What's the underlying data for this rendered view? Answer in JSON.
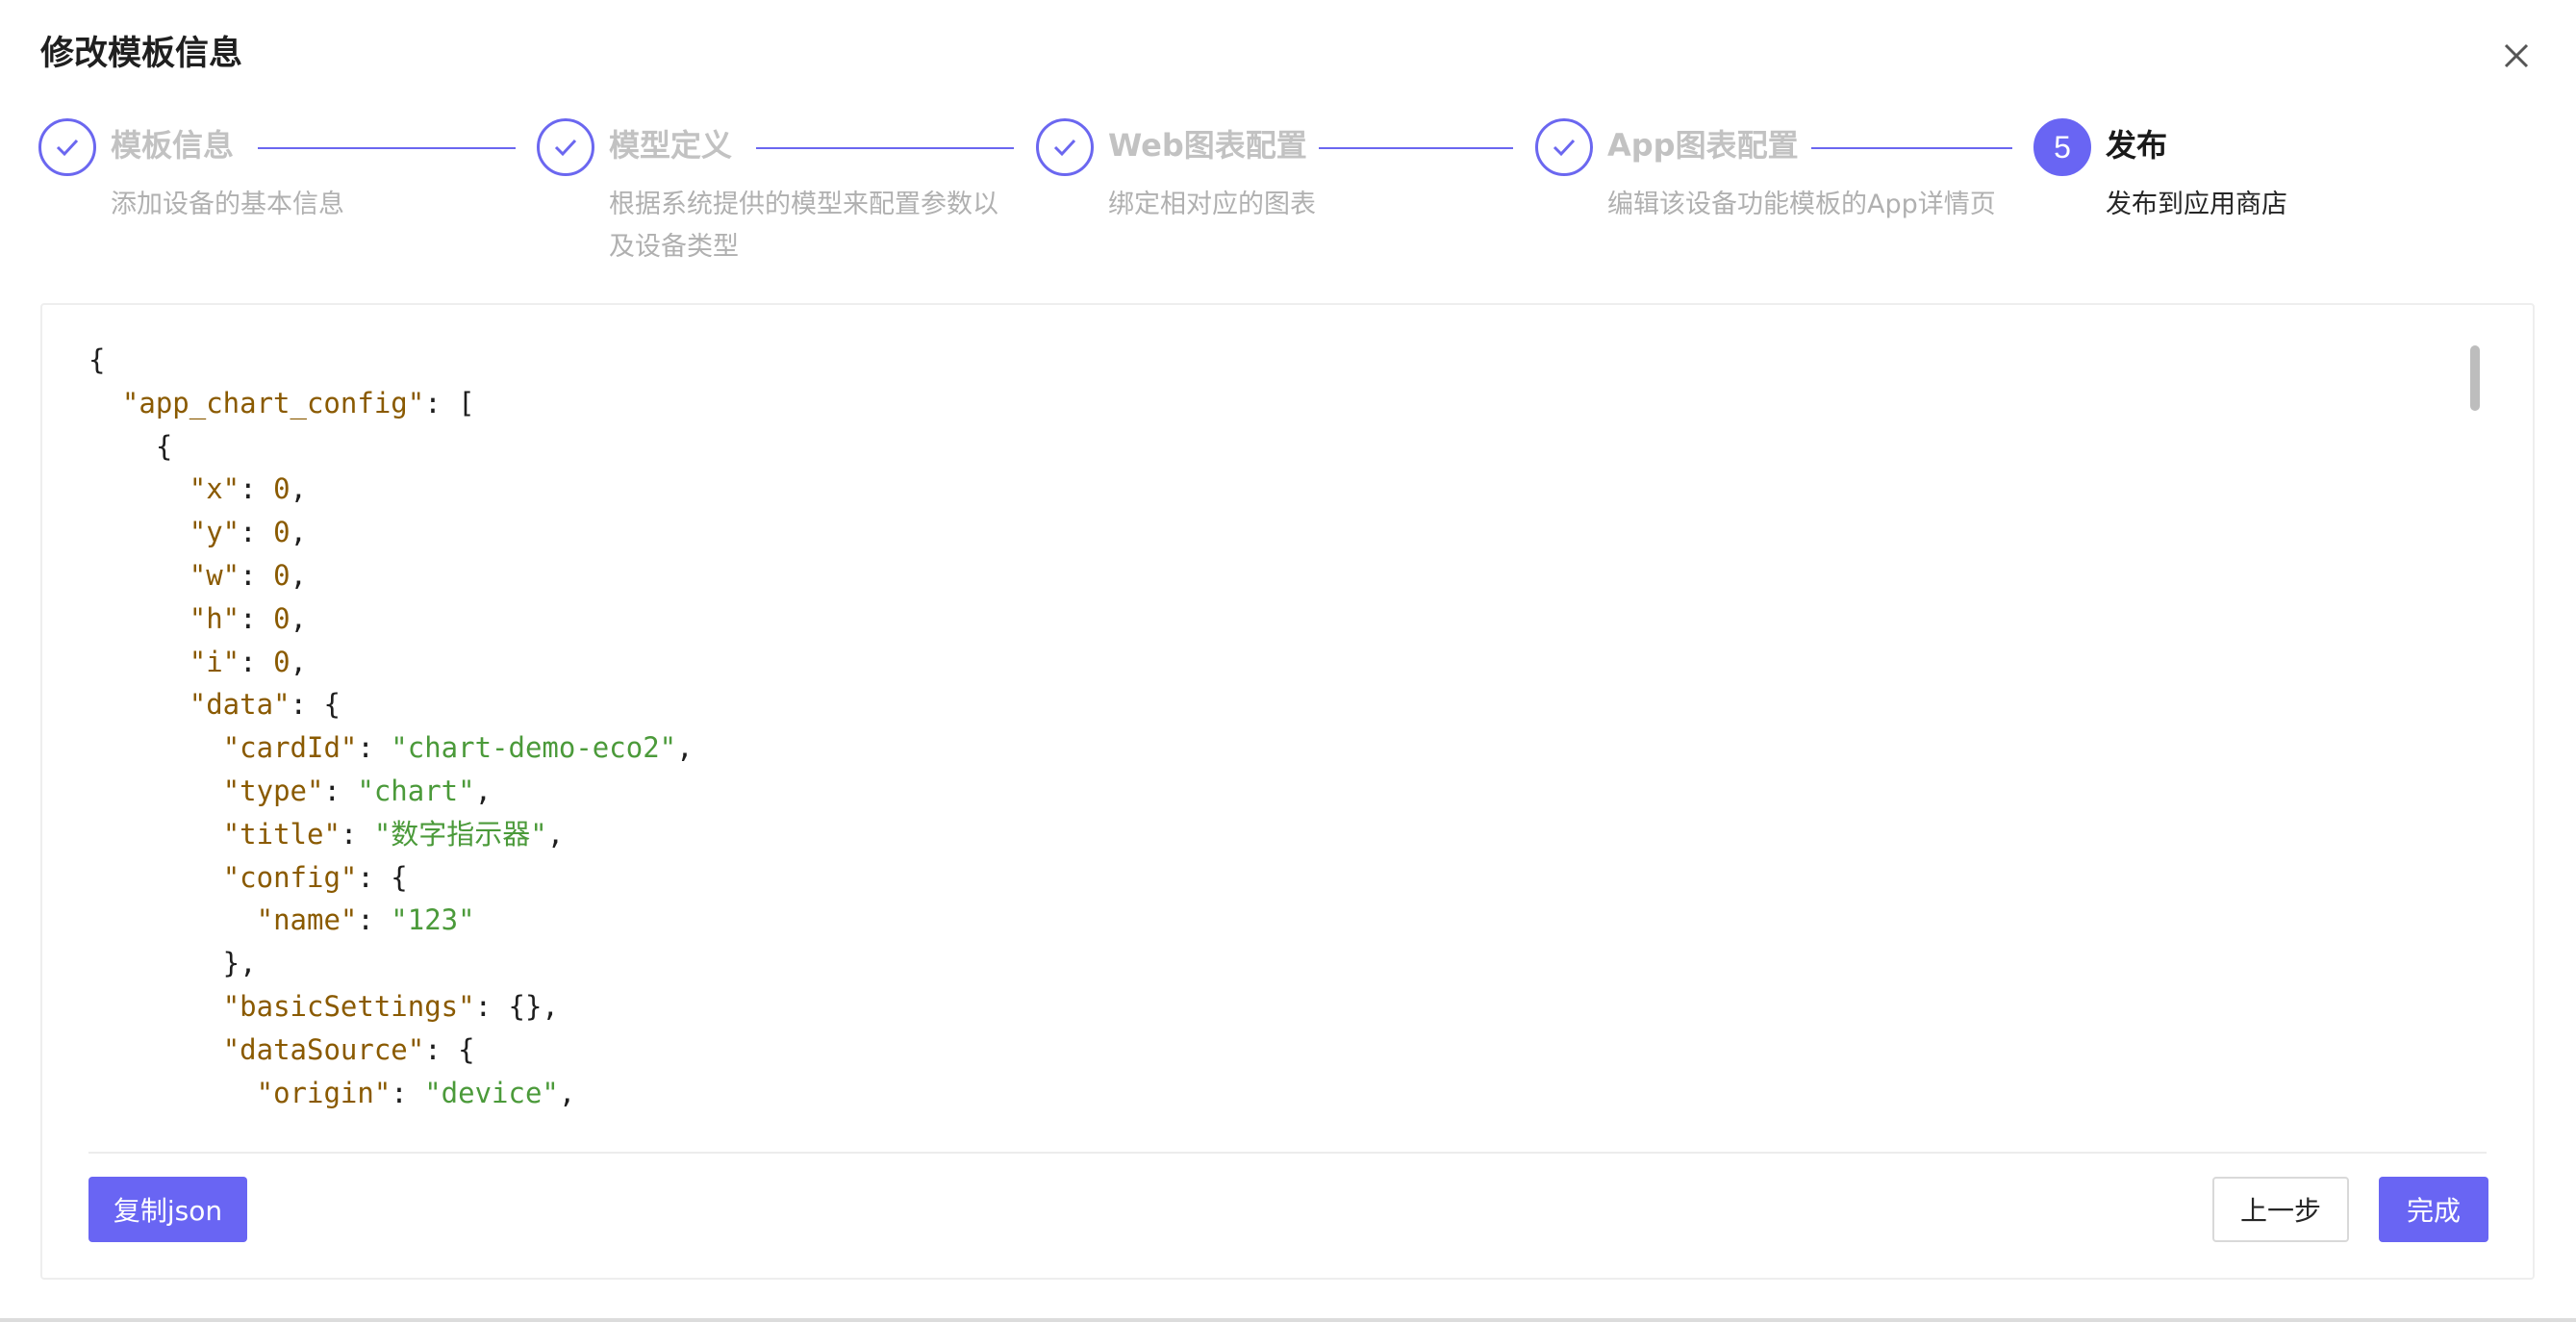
{
  "dialog": {
    "title": "修改模板信息",
    "close_icon": "close-icon"
  },
  "steps": [
    {
      "title": "模板信息",
      "desc": "添加设备的基本信息",
      "status": "done"
    },
    {
      "title": "模型定义",
      "desc": "根据系统提供的模型来配置参数以及设备类型",
      "status": "done"
    },
    {
      "title": "Web图表配置",
      "desc": "绑定相对应的图表",
      "status": "done"
    },
    {
      "title": "App图表配置",
      "desc": "编辑该设备功能模板的App详情页",
      "status": "done"
    },
    {
      "title": "发布",
      "desc": "发布到应用商店",
      "status": "active",
      "number": "5"
    }
  ],
  "code_lines": [
    [
      [
        "p",
        "{"
      ]
    ],
    [
      [
        "p",
        "  "
      ],
      [
        "k",
        "\"app_chart_config\""
      ],
      [
        "p",
        ": ["
      ]
    ],
    [
      [
        "p",
        "    {"
      ]
    ],
    [
      [
        "p",
        "      "
      ],
      [
        "k",
        "\"x\""
      ],
      [
        "p",
        ": "
      ],
      [
        "n",
        "0"
      ],
      [
        "p",
        ","
      ]
    ],
    [
      [
        "p",
        "      "
      ],
      [
        "k",
        "\"y\""
      ],
      [
        "p",
        ": "
      ],
      [
        "n",
        "0"
      ],
      [
        "p",
        ","
      ]
    ],
    [
      [
        "p",
        "      "
      ],
      [
        "k",
        "\"w\""
      ],
      [
        "p",
        ": "
      ],
      [
        "n",
        "0"
      ],
      [
        "p",
        ","
      ]
    ],
    [
      [
        "p",
        "      "
      ],
      [
        "k",
        "\"h\""
      ],
      [
        "p",
        ": "
      ],
      [
        "n",
        "0"
      ],
      [
        "p",
        ","
      ]
    ],
    [
      [
        "p",
        "      "
      ],
      [
        "k",
        "\"i\""
      ],
      [
        "p",
        ": "
      ],
      [
        "n",
        "0"
      ],
      [
        "p",
        ","
      ]
    ],
    [
      [
        "p",
        "      "
      ],
      [
        "k",
        "\"data\""
      ],
      [
        "p",
        ": {"
      ]
    ],
    [
      [
        "p",
        "        "
      ],
      [
        "k",
        "\"cardId\""
      ],
      [
        "p",
        ": "
      ],
      [
        "s",
        "\"chart-demo-eco2\""
      ],
      [
        "p",
        ","
      ]
    ],
    [
      [
        "p",
        "        "
      ],
      [
        "k",
        "\"type\""
      ],
      [
        "p",
        ": "
      ],
      [
        "s",
        "\"chart\""
      ],
      [
        "p",
        ","
      ]
    ],
    [
      [
        "p",
        "        "
      ],
      [
        "k",
        "\"title\""
      ],
      [
        "p",
        ": "
      ],
      [
        "s",
        "\"数字指示器\""
      ],
      [
        "p",
        ","
      ]
    ],
    [
      [
        "p",
        "        "
      ],
      [
        "k",
        "\"config\""
      ],
      [
        "p",
        ": {"
      ]
    ],
    [
      [
        "p",
        "          "
      ],
      [
        "k",
        "\"name\""
      ],
      [
        "p",
        ": "
      ],
      [
        "s",
        "\"123\""
      ]
    ],
    [
      [
        "p",
        "        },"
      ]
    ],
    [
      [
        "p",
        "        "
      ],
      [
        "k",
        "\"basicSettings\""
      ],
      [
        "p",
        ": {},"
      ]
    ],
    [
      [
        "p",
        "        "
      ],
      [
        "k",
        "\"dataSource\""
      ],
      [
        "p",
        ": {"
      ]
    ],
    [
      [
        "p",
        "          "
      ],
      [
        "k",
        "\"origin\""
      ],
      [
        "p",
        ": "
      ],
      [
        "s",
        "\"device\""
      ],
      [
        "p",
        ","
      ]
    ]
  ],
  "buttons": {
    "copy_json": "复制json",
    "prev": "上一步",
    "finish": "完成"
  }
}
